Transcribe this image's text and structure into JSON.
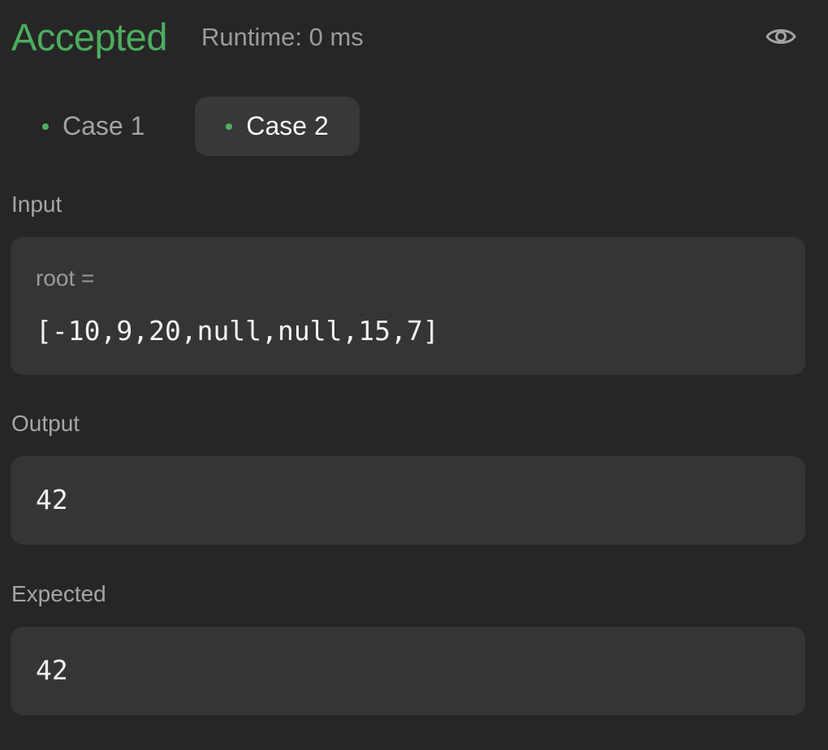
{
  "header": {
    "status": "Accepted",
    "runtime": "Runtime: 0 ms",
    "eye_icon": "eye-icon"
  },
  "tabs": [
    {
      "label": "Case 1",
      "active": false
    },
    {
      "label": "Case 2",
      "active": true
    }
  ],
  "input": {
    "label": "Input",
    "var_name": "root =",
    "value": "[-10,9,20,null,null,15,7]"
  },
  "output": {
    "label": "Output",
    "value": "42"
  },
  "expected": {
    "label": "Expected",
    "value": "42"
  },
  "colors": {
    "accent_green": "#4cae5f",
    "background": "#262626",
    "box": "#353535"
  }
}
